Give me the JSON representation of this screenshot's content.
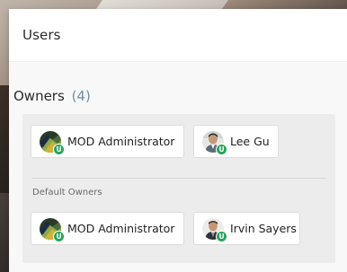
{
  "panel": {
    "title": "Users"
  },
  "owners": {
    "title": "Owners",
    "count": "(4)",
    "members": [
      {
        "name": "MOD Administrator",
        "badge": "U",
        "avatar": "mod-administrator-avatar"
      },
      {
        "name": "Lee Gu",
        "badge": "U",
        "avatar": "lee-gu-avatar"
      }
    ],
    "default_label": "Default Owners",
    "default_members": [
      {
        "name": "MOD Administrator",
        "badge": "U",
        "avatar": "mod-administrator-avatar"
      },
      {
        "name": "Irvin Sayers",
        "badge": "U",
        "avatar": "irvin-sayers-avatar"
      }
    ]
  },
  "colors": {
    "badge": "#27a55a",
    "count": "#6c8ca3",
    "box": "#ececec"
  }
}
